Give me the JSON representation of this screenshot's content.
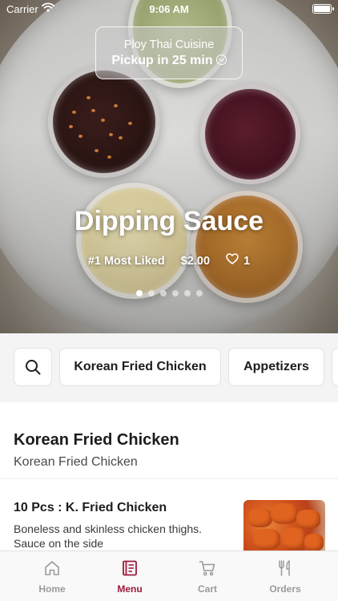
{
  "status_bar": {
    "carrier": "Carrier",
    "time": "9:06 AM"
  },
  "pickup": {
    "restaurant": "Ploy Thai Cuisine",
    "eta": "Pickup in 25 min"
  },
  "hero": {
    "title": "Dipping Sauce",
    "rank": "#1 Most Liked",
    "price": "$2.00",
    "likes": "1",
    "page_count": 6,
    "active_page": 1
  },
  "categories": {
    "items": [
      "Korean Fried Chicken",
      "Appetizers",
      ""
    ]
  },
  "section": {
    "title": "Korean Fried Chicken",
    "subtitle": "Korean Fried Chicken"
  },
  "menu_item": {
    "name": "10 Pcs : K. Fried Chicken",
    "description": "Boneless and skinless chicken thighs. Sauce on the side"
  },
  "tab_bar": {
    "home": "Home",
    "menu": "Menu",
    "cart": "Cart",
    "orders": "Orders",
    "active": "menu"
  },
  "colors": {
    "accent": "#9b1b3c",
    "inactive_tab": "#9a9a9e",
    "category_bg": "#f4f4f5"
  }
}
